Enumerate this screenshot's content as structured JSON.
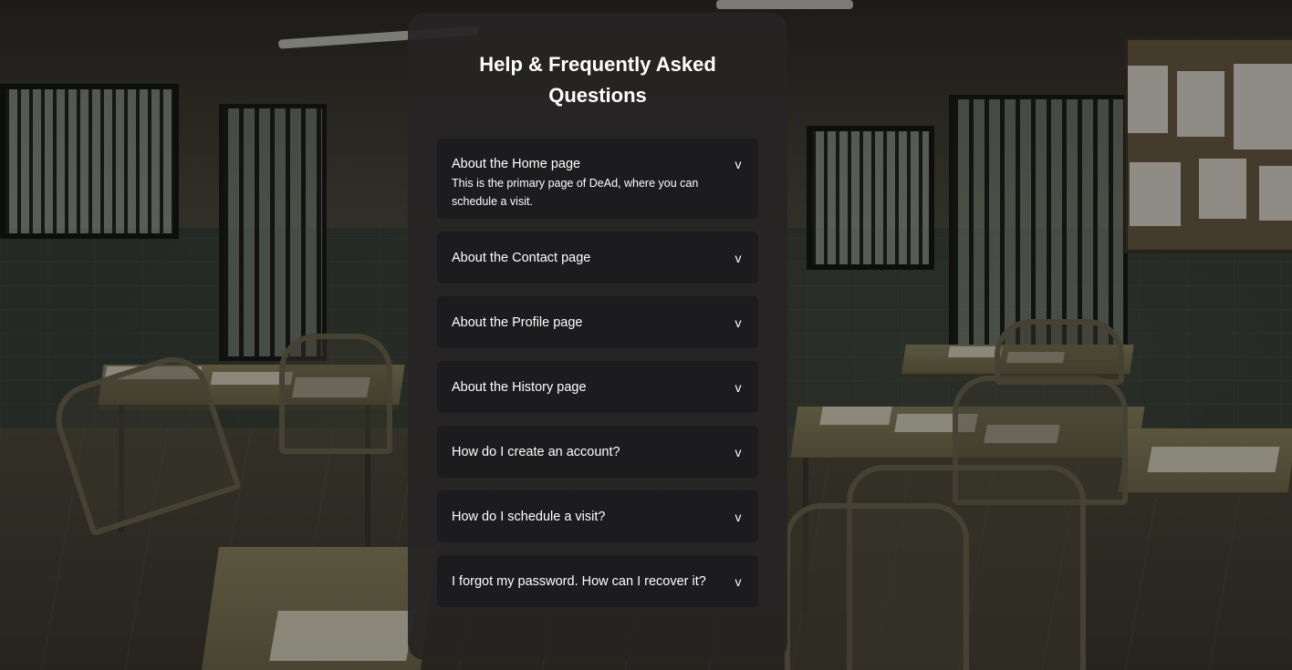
{
  "page": {
    "title": "Help & Frequently Asked Questions"
  },
  "faq": {
    "chevron_glyph": "v",
    "items": [
      {
        "question": "About the Home page",
        "answer": "This is the primary page of DeAd, where you can schedule a visit.",
        "expanded": true
      },
      {
        "question": "About the Contact page",
        "expanded": false
      },
      {
        "question": "About the Profile page",
        "expanded": false
      },
      {
        "question": "About the History page",
        "expanded": false
      },
      {
        "question": "How do I create an account?",
        "expanded": false
      },
      {
        "question": "How do I schedule a visit?",
        "expanded": false
      },
      {
        "question": "I forgot my password. How can I recover it?",
        "expanded": false
      }
    ]
  },
  "colors": {
    "panel_background": "#262424",
    "item_background": "#1c1b1d",
    "text": "#ffffff"
  }
}
